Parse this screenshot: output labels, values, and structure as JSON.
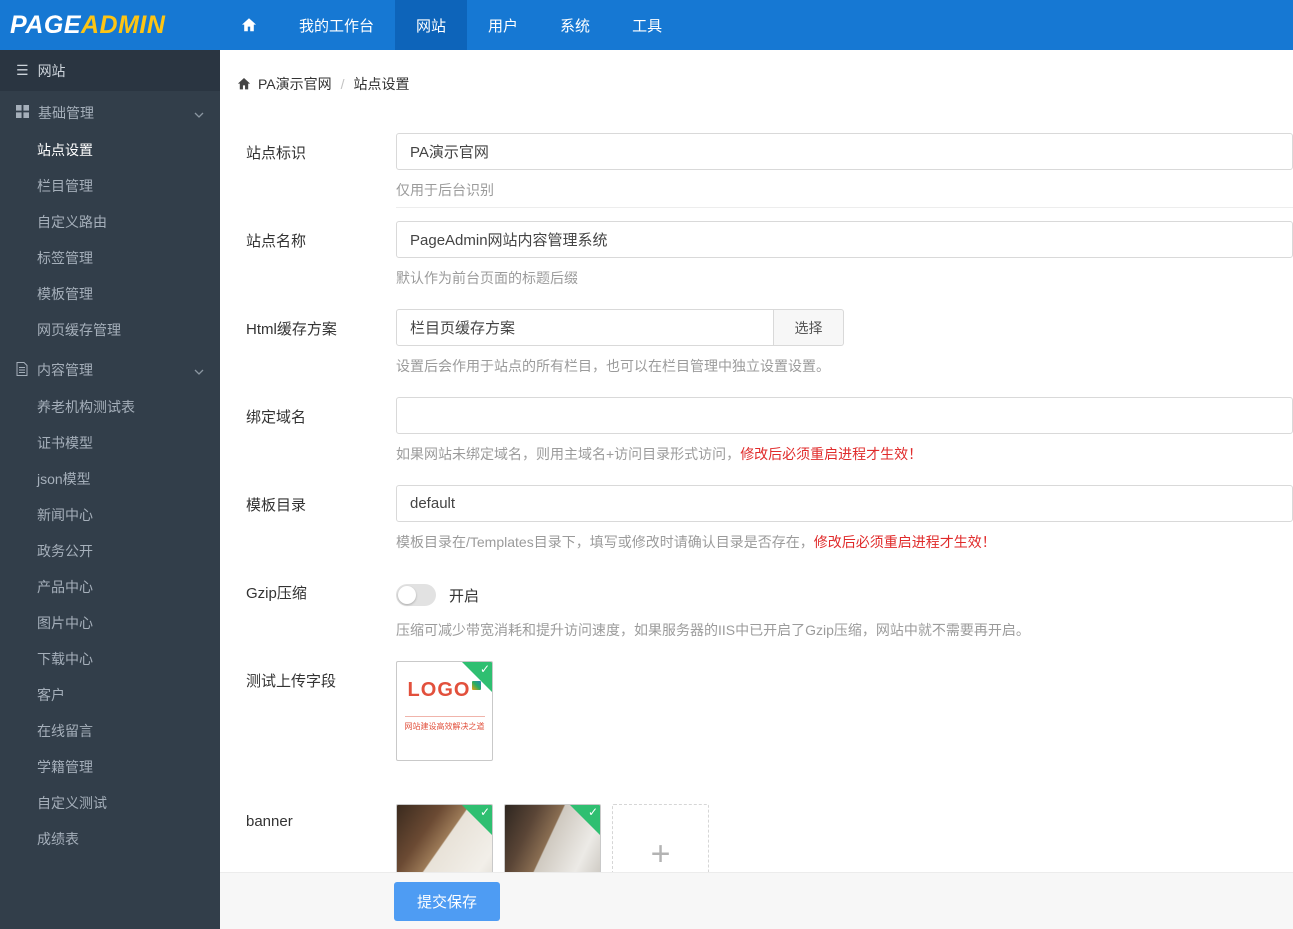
{
  "topnav": {
    "logo": {
      "part1": "PAGE",
      "part2": "ADMIN"
    },
    "items": [
      {
        "label": "我的工作台"
      },
      {
        "label": "网站"
      },
      {
        "label": "用户"
      },
      {
        "label": "系统"
      },
      {
        "label": "工具"
      }
    ]
  },
  "sidebar": {
    "title": "网站",
    "groups": [
      {
        "label": "基础管理",
        "items": [
          "站点设置",
          "栏目管理",
          "自定义路由",
          "标签管理",
          "模板管理",
          "网页缓存管理"
        ]
      },
      {
        "label": "内容管理",
        "items": [
          "养老机构测试表",
          "证书模型",
          "json模型",
          "新闻中心",
          "政务公开",
          "产品中心",
          "图片中心",
          "下载中心",
          "客户",
          "在线留言",
          "学籍管理",
          "自定义测试",
          "成绩表"
        ]
      }
    ]
  },
  "breadcrumb": {
    "site": "PA演示官网",
    "separator": "/",
    "page": "站点设置"
  },
  "form": {
    "site_id": {
      "label": "站点标识",
      "value": "PA演示官网",
      "help": "仅用于后台识别"
    },
    "site_name": {
      "label": "站点名称",
      "value": "PageAdmin网站内容管理系统",
      "help": "默认作为前台页面的标题后缀"
    },
    "html_cache": {
      "label": "Html缓存方案",
      "value": "栏目页缓存方案",
      "select_button": "选择",
      "help": "设置后会作用于站点的所有栏目，也可以在栏目管理中独立设置设置。"
    },
    "bind_domain": {
      "label": "绑定域名",
      "value": "",
      "help": "如果网站未绑定域名，则用主域名+访问目录形式访问，",
      "help_warning": "修改后必须重启进程才生效！"
    },
    "template_dir": {
      "label": "模板目录",
      "value": "default",
      "help": "模板目录在/Templates目录下，填写或修改时请确认目录是否存在，",
      "help_warning": "修改后必须重启进程才生效！"
    },
    "gzip": {
      "label": "Gzip压缩",
      "state_label": "开启",
      "state": "off",
      "help": "压缩可减少带宽消耗和提升访问速度，如果服务器的IIS中已开启了Gzip压缩，网站中就不需要再开启。"
    },
    "upload_test": {
      "label": "测试上传字段",
      "logo_text": "LOGO",
      "logo_subtext": "网站建设高效解决之道"
    },
    "banner": {
      "label": "banner"
    }
  },
  "icons": {
    "hamburger": "☰",
    "check": "✓",
    "plus": "+"
  },
  "colors": {
    "navbar": "#1678d3",
    "navbar_active": "#0d64ba",
    "sidebar": "#323e4a",
    "accent_blue": "#4e9cf3",
    "success_green": "#2fbf71",
    "warning_red": "#e02b2b",
    "logo_yellow": "#fdc514"
  },
  "footer": {
    "submit_label": "提交保存"
  }
}
